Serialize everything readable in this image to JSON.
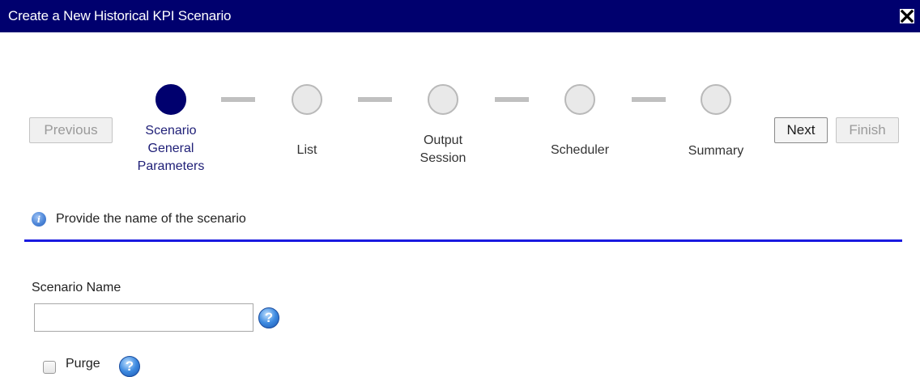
{
  "dialog": {
    "title": "Create a New Historical KPI Scenario",
    "close_icon": "close-icon"
  },
  "nav": {
    "previous_label": "Previous",
    "next_label": "Next",
    "finish_label": "Finish"
  },
  "steps": [
    {
      "label_lines": [
        "Scenario",
        "General",
        "Parameters"
      ],
      "state": "active"
    },
    {
      "label_lines": [
        "List"
      ],
      "state": "inactive"
    },
    {
      "label_lines": [
        "Output",
        "Session"
      ],
      "state": "inactive"
    },
    {
      "label_lines": [
        "Scheduler"
      ],
      "state": "inactive"
    },
    {
      "label_lines": [
        "Summary"
      ],
      "state": "inactive"
    }
  ],
  "info": {
    "icon": "info-icon",
    "text": "Provide the name of the scenario"
  },
  "form": {
    "scenario_name_label": "Scenario Name",
    "scenario_name_value": "",
    "purge_label": "Purge",
    "purge_checked": false,
    "help_icon": "help-icon"
  },
  "colors": {
    "titlebar": "#00006e",
    "active_step": "#00006e",
    "divider": "#1a1ae0"
  }
}
